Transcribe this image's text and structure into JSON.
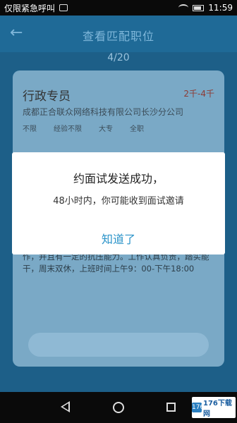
{
  "status_bar": {
    "left_text": "仅限紧急呼叫",
    "time": "11:59"
  },
  "header": {
    "title": "查看匹配职位",
    "pager": "4/20"
  },
  "job": {
    "title": "行政专员",
    "salary": "2千-4千",
    "company": "成都正合联众网络科技有限公司长沙分公司",
    "tags": [
      "不限",
      "经验不限",
      "大专",
      "全职"
    ],
    "description": "作，并且有一定的抗压能力。工作认真负责，踏实能干，周末双休，上班时间上午9：00-下午18:00"
  },
  "dialog": {
    "title": "约面试发送成功，",
    "message": "48小时内，你可能收到面试邀请",
    "confirm_label": "知道了"
  },
  "watermark": {
    "mark": "176",
    "text": "176下载网"
  },
  "colors": {
    "accent": "#2a93c9",
    "overlay_header": "#1f6a97"
  }
}
